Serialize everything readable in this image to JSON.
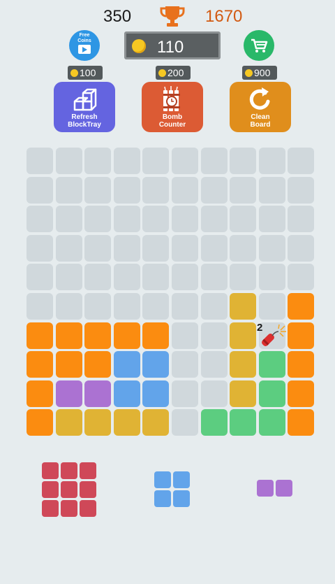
{
  "header": {
    "score": "350",
    "best_score": "1670",
    "trophy_icon": "trophy-icon",
    "trophy_color": "#e8711d"
  },
  "coins": {
    "balance": "110",
    "free_coins_label": "Free\nCoins",
    "free_coins_icon": "film-play-icon",
    "shop_icon": "cart-icon"
  },
  "powerups": [
    {
      "key": "refresh",
      "cost": "100",
      "label": "Refresh\nBlockTray",
      "color": "#6464e0",
      "icon": "blocks-icon"
    },
    {
      "key": "bomb",
      "cost": "200",
      "label": "Bomb\nCounter",
      "color": "#dc5b34",
      "icon": "dynamite-clock-icon"
    },
    {
      "key": "clean",
      "cost": "900",
      "label": "Clean\nBoard",
      "color": "#e08e1c",
      "icon": "refresh-arrow-icon"
    }
  ],
  "palette": {
    "E": "#d0d8dc",
    "O": "#fb8c10",
    "Y": "#e0b334",
    "B": "#62a4ea",
    "P": "#ab72d2",
    "G": "#5ccd80",
    "R": "#cf4858"
  },
  "board": {
    "rows": [
      "EEEEEEEEEE",
      "EEEEEEEEEE",
      "EEEEEEEEEE",
      "EEEEEEEEEE",
      "EEEEEEEEEE",
      "EEEEEEEYEO",
      "OOOOOEEYEO",
      "OOOBBEEYGO",
      "OPPBBEEYGO",
      "OYYYYEGGGO"
    ],
    "bomb": {
      "row": 6,
      "col": 8,
      "counter": "2"
    }
  },
  "tray": [
    {
      "color": "R",
      "shape": [
        "XXX",
        "XXX",
        "XXX"
      ]
    },
    {
      "color": "B",
      "shape": [
        "XX",
        "XX"
      ]
    },
    {
      "color": "P",
      "shape": [
        "XX"
      ]
    }
  ]
}
